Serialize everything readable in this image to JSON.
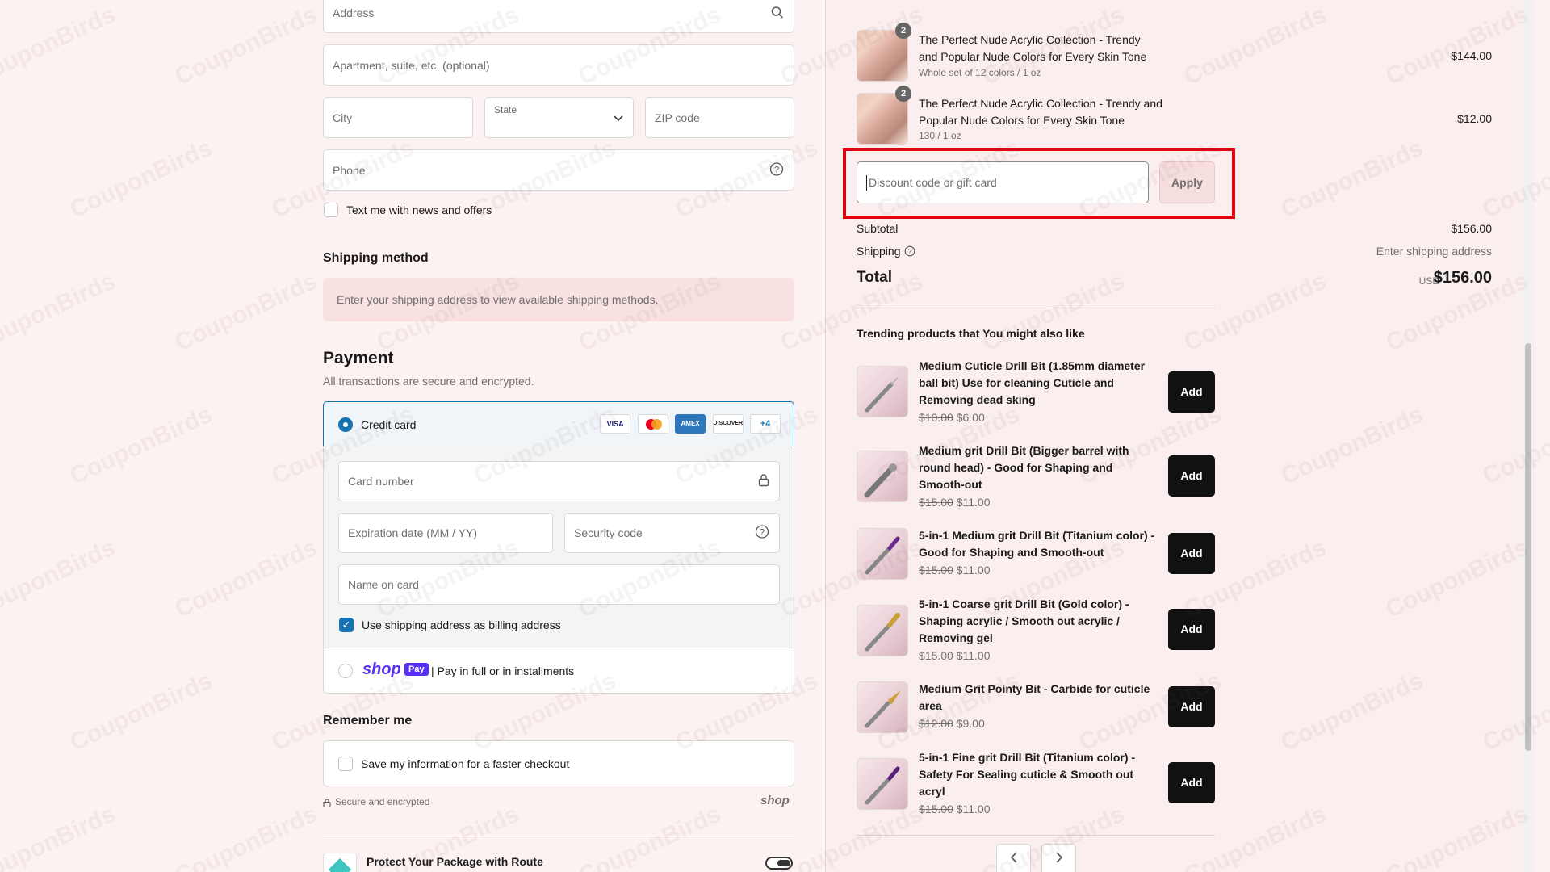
{
  "watermark": "CouponBirds",
  "address_form": {
    "address_placeholder": "Address",
    "apartment_placeholder": "Apartment, suite, etc. (optional)",
    "city_placeholder": "City",
    "state_label": "State",
    "zip_placeholder": "ZIP code",
    "phone_placeholder": "Phone",
    "text_me_label": "Text me with news and offers"
  },
  "shipping_method": {
    "title": "Shipping method",
    "notice": "Enter your shipping address to view available shipping methods."
  },
  "payment": {
    "title": "Payment",
    "subtitle": "All transactions are secure and encrypted.",
    "credit_card_label": "Credit card",
    "card_logos": [
      "VISA",
      "MC",
      "AMEX",
      "DISCOVER"
    ],
    "more_cards": "+4",
    "card_number_placeholder": "Card number",
    "expiration_placeholder": "Expiration date (MM / YY)",
    "security_code_placeholder": "Security code",
    "name_on_card_placeholder": "Name on card",
    "billing_same_label": "Use shipping address as billing address",
    "shop_pay_logo": "shop",
    "shop_pay_badge": "Pay",
    "shop_pay_label": "| Pay in full or in installments"
  },
  "remember_me": {
    "title": "Remember me",
    "save_label": "Save my information for a faster checkout",
    "secure_label": "Secure and encrypted",
    "shop_logo": "shop"
  },
  "route": {
    "label": "Protect Your Package with Route"
  },
  "cart": {
    "items": [
      {
        "qty": "2",
        "title": "The Perfect Nude Acrylic Collection - Trendy and Popular Nude Colors for Every Skin Tone",
        "variant": "Whole set of 12 colors / 1 oz",
        "price": "$144.00"
      },
      {
        "qty": "2",
        "title": "The Perfect Nude Acrylic Collection - Trendy and Popular Nude Colors for Every Skin Tone",
        "variant": "130 / 1 oz",
        "price": "$12.00"
      }
    ],
    "discount_placeholder": "Discount code or gift card",
    "apply_label": "Apply",
    "subtotal_label": "Subtotal",
    "subtotal_value": "$156.00",
    "shipping_label": "Shipping",
    "shipping_value": "Enter shipping address",
    "total_label": "Total",
    "total_currency": "USD",
    "total_value": "$156.00",
    "highlight_color": "#e0000f"
  },
  "trending": {
    "title": "Trending products that You might also like",
    "add_label": "Add",
    "items": [
      {
        "title": "Medium Cuticle Drill Bit (1.85mm diameter ball bit) Use for cleaning Cuticle and Removing dead sking",
        "old_price": "$10.00",
        "price": "$6.00"
      },
      {
        "title": "Medium grit Drill Bit (Bigger barrel with round head) - Good for Shaping and Smooth-out",
        "old_price": "$15.00",
        "price": "$11.00"
      },
      {
        "title": "5-in-1 Medium grit Drill Bit (Titanium color) - Good for Shaping and Smooth-out",
        "old_price": "$15.00",
        "price": "$11.00"
      },
      {
        "title": "5-in-1 Coarse grit Drill Bit (Gold color) - Shaping acrylic / Smooth out acrylic / Removing gel",
        "old_price": "$15.00",
        "price": "$11.00"
      },
      {
        "title": "Medium Grit Pointy Bit - Carbide for cuticle area",
        "old_price": "$12.00",
        "price": "$9.00"
      },
      {
        "title": "5-in-1 Fine grit Drill Bit (Titanium color) - Safety For Sealing cuticle & Smooth out acryl",
        "old_price": "$15.00",
        "price": "$11.00"
      }
    ]
  }
}
